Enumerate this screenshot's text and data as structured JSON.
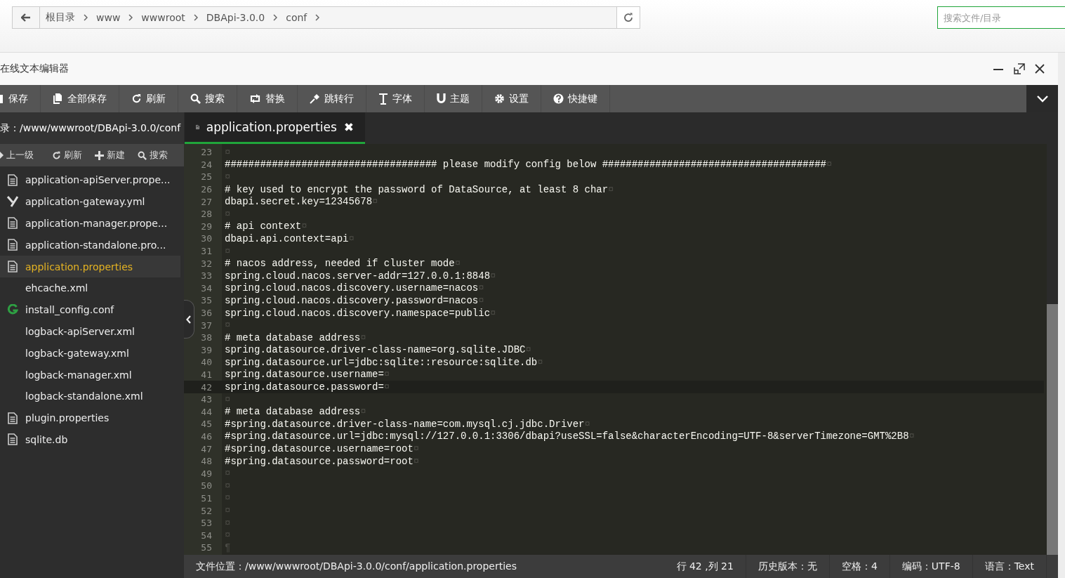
{
  "breadcrumb": {
    "items": [
      "根目录",
      "www",
      "wwwroot",
      "DBApi-3.0.0",
      "conf"
    ]
  },
  "search": {
    "placeholder": "搜索文件/目录"
  },
  "window": {
    "title": "在线文本编辑器"
  },
  "toolbar": [
    "保存",
    "全部保存",
    "刷新",
    "搜索",
    "替换",
    "跳转行",
    "字体",
    "主题",
    "设置",
    "快捷键"
  ],
  "sidebar": {
    "path": "录：/www/wwwroot/DBApi-3.0.0/conf",
    "actions": [
      "上一级",
      "刷新",
      "新建",
      "搜索"
    ],
    "files": [
      {
        "name": "application-apiServer.prope...",
        "kind": "doc",
        "selected": false
      },
      {
        "name": "application-gateway.yml",
        "kind": "yaml",
        "selected": false
      },
      {
        "name": "application-manager.prope...",
        "kind": "doc",
        "selected": false
      },
      {
        "name": "application-standalone.pro...",
        "kind": "doc",
        "selected": false
      },
      {
        "name": "application.properties",
        "kind": "doc",
        "selected": true
      },
      {
        "name": "ehcache.xml",
        "kind": "plain",
        "selected": false
      },
      {
        "name": "install_config.conf",
        "kind": "conf",
        "selected": false
      },
      {
        "name": "logback-apiServer.xml",
        "kind": "plain",
        "selected": false
      },
      {
        "name": "logback-gateway.xml",
        "kind": "plain",
        "selected": false
      },
      {
        "name": "logback-manager.xml",
        "kind": "plain",
        "selected": false
      },
      {
        "name": "logback-standalone.xml",
        "kind": "plain",
        "selected": false
      },
      {
        "name": "plugin.properties",
        "kind": "doc",
        "selected": false
      },
      {
        "name": "sqlite.db",
        "kind": "doc",
        "selected": false
      }
    ]
  },
  "tab": {
    "label": "application.properties",
    "close": "✖"
  },
  "code": [
    {
      "n": "23",
      "eol": "¤",
      "current": false
    },
    {
      "n": "24",
      "text": "#################################### please modify config below ######################################",
      "eol": "¤",
      "current": false
    },
    {
      "n": "25",
      "eol": "¤",
      "current": false
    },
    {
      "n": "26",
      "text": "# key used to encrypt the password of DataSource, at least 8 char",
      "eol": "¤",
      "current": false
    },
    {
      "n": "27",
      "text": "dbapi.secret.key=12345678",
      "eol": "¤",
      "current": false
    },
    {
      "n": "28",
      "eol": "¤",
      "current": false
    },
    {
      "n": "29",
      "text": "# api context",
      "eol": "¤",
      "current": false
    },
    {
      "n": "30",
      "text": "dbapi.api.context=api",
      "eol": "¤",
      "current": false
    },
    {
      "n": "31",
      "eol": "¤",
      "current": false
    },
    {
      "n": "32",
      "text": "# nacos address, needed if cluster mode",
      "eol": "¤",
      "current": false
    },
    {
      "n": "33",
      "text": "spring.cloud.nacos.server-addr=127.0.0.1:8848",
      "eol": "¤",
      "current": false
    },
    {
      "n": "34",
      "text": "spring.cloud.nacos.discovery.username=nacos",
      "eol": "¤",
      "current": false
    },
    {
      "n": "35",
      "text": "spring.cloud.nacos.discovery.password=nacos",
      "eol": "¤",
      "current": false
    },
    {
      "n": "36",
      "text": "spring.cloud.nacos.discovery.namespace=public",
      "eol": "¤",
      "current": false
    },
    {
      "n": "37",
      "eol": "¤",
      "current": false
    },
    {
      "n": "38",
      "text": "# meta database address",
      "eol": "¤",
      "current": false
    },
    {
      "n": "39",
      "text": "spring.datasource.driver-class-name=org.sqlite.JDBC",
      "eol": "¤",
      "current": false
    },
    {
      "n": "40",
      "text": "spring.datasource.url=jdbc:sqlite::resource:sqlite.db",
      "eol": "¤",
      "current": false
    },
    {
      "n": "41",
      "text": "spring.datasource.username=",
      "eol": "¤",
      "current": false
    },
    {
      "n": "42",
      "text": "spring.datasource.password=",
      "eol": "¤",
      "current": true
    },
    {
      "n": "43",
      "eol": "¤",
      "current": false
    },
    {
      "n": "44",
      "text": "# meta database address",
      "eol": "¤",
      "current": false
    },
    {
      "n": "45",
      "text": "#spring.datasource.driver-class-name=com.mysql.cj.jdbc.Driver",
      "eol": "¤",
      "current": false
    },
    {
      "n": "46",
      "text": "#spring.datasource.url=jdbc:mysql://127.0.0.1:3306/dbapi?useSSL=false&characterEncoding=UTF-8&serverTimezone=GMT%2B8",
      "eol": "¤",
      "current": false
    },
    {
      "n": "47",
      "text": "#spring.datasource.username=root",
      "eol": "¤",
      "current": false
    },
    {
      "n": "48",
      "text": "#spring.datasource.password=root",
      "eol": "¤",
      "current": false
    },
    {
      "n": "49",
      "eol": "¤",
      "current": false
    },
    {
      "n": "50",
      "eol": "¤",
      "current": false
    },
    {
      "n": "51",
      "eol": "¤",
      "current": false
    },
    {
      "n": "52",
      "eol": "¤",
      "current": false
    },
    {
      "n": "53",
      "eol": "¤",
      "current": false
    },
    {
      "n": "54",
      "eol": "¤",
      "current": false
    },
    {
      "n": "55",
      "eol": "¶",
      "current": false
    }
  ],
  "status_bar": {
    "path": "文件位置：/www/wwwroot/DBApi-3.0.0/conf/application.properties",
    "position": "行 42 ,列 21",
    "history": "历史版本：无",
    "indent": "空格：4",
    "encoding": "编码：UTF-8",
    "language": "语言：Text"
  }
}
